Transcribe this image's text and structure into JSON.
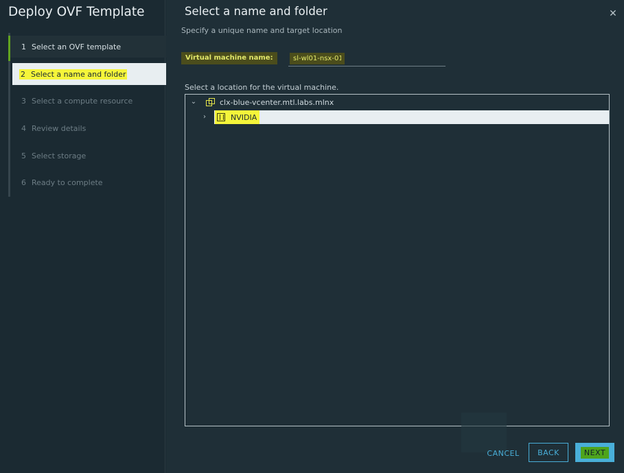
{
  "dialog": {
    "title": "Deploy OVF Template",
    "close_glyph": "✕"
  },
  "steps": [
    {
      "num": "1",
      "label": "Select an OVF template",
      "state": "done"
    },
    {
      "num": "2",
      "label": "Select a name and folder",
      "state": "active"
    },
    {
      "num": "3",
      "label": "Select a compute resource",
      "state": "pending"
    },
    {
      "num": "4",
      "label": "Review details",
      "state": "pending"
    },
    {
      "num": "5",
      "label": "Select storage",
      "state": "pending"
    },
    {
      "num": "6",
      "label": "Ready to complete",
      "state": "pending"
    }
  ],
  "page": {
    "title": "Select a name and folder",
    "subtitle": "Specify a unique name and target location"
  },
  "vm_name": {
    "label": "Virtual machine name:",
    "value": "sl-wl01-nsx-01"
  },
  "location": {
    "label": "Select a location for the virtual machine.",
    "tree": [
      {
        "label": "clx-blue-vcenter.mtl.labs.mlnx",
        "icon": "vcenter-icon",
        "expanded": true
      },
      {
        "label": "NVIDIA",
        "icon": "datacenter-icon",
        "expanded": false,
        "selected": true
      }
    ]
  },
  "footer": {
    "cancel": "CANCEL",
    "back": "BACK",
    "next": "NEXT"
  },
  "colors": {
    "accent": "#49afd9",
    "done_marker": "#62a420",
    "highlight": "#f5f53a"
  }
}
